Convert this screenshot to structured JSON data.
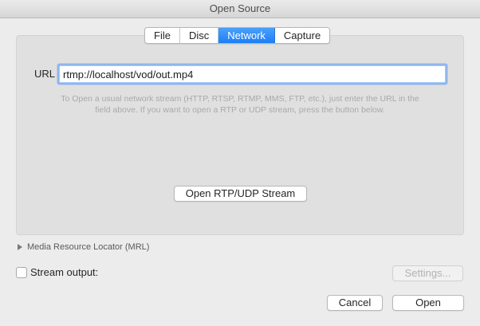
{
  "window": {
    "title": "Open Source"
  },
  "tabs": [
    {
      "label": "File",
      "active": false
    },
    {
      "label": "Disc",
      "active": false
    },
    {
      "label": "Network",
      "active": true
    },
    {
      "label": "Capture",
      "active": false
    }
  ],
  "network": {
    "url_label": "URL",
    "url_value": "rtmp://localhost/vod/out.mp4",
    "help_line1": "To Open a usual network stream (HTTP, RTSP, RTMP, MMS, FTP, etc.), just enter the URL in the",
    "help_line2": "field above. If you want to open a RTP or UDP stream, press the button below.",
    "rtp_button": "Open RTP/UDP Stream"
  },
  "mrl": {
    "label": "Media Resource Locator (MRL)",
    "expanded": false
  },
  "stream_output": {
    "label": "Stream output:",
    "checked": false,
    "settings_button": "Settings..."
  },
  "footer": {
    "cancel": "Cancel",
    "open": "Open"
  },
  "colors": {
    "accent": "#1c7ff8",
    "focus_ring": "#8fb6ee"
  }
}
